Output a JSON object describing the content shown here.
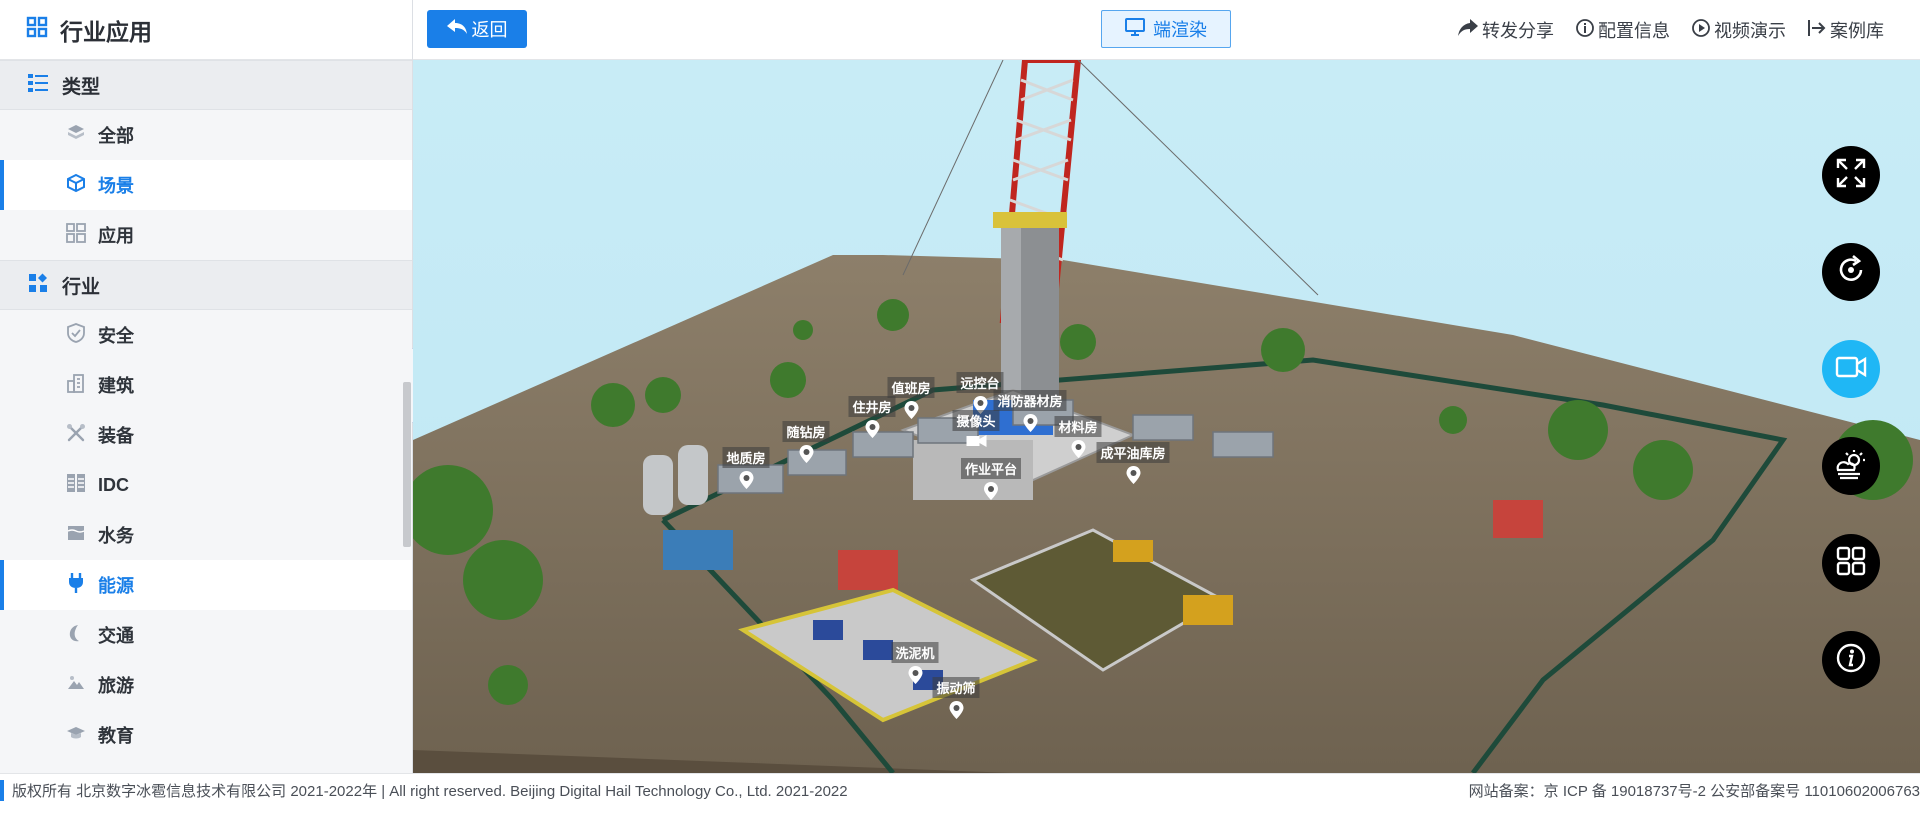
{
  "sidebar": {
    "title": "行业应用",
    "sections": [
      {
        "label": "类型",
        "items": [
          {
            "label": "全部",
            "icon": "cube-stack-icon"
          },
          {
            "label": "场景",
            "icon": "cube-icon",
            "active": true
          },
          {
            "label": "应用",
            "icon": "grid-apps-icon"
          }
        ]
      },
      {
        "label": "行业",
        "items": [
          {
            "label": "安全",
            "icon": "shield-icon"
          },
          {
            "label": "建筑",
            "icon": "building-icon"
          },
          {
            "label": "装备",
            "icon": "tools-icon"
          },
          {
            "label": "IDC",
            "icon": "server-icon"
          },
          {
            "label": "水务",
            "icon": "water-icon"
          },
          {
            "label": "能源",
            "icon": "plug-icon",
            "active": true
          },
          {
            "label": "交通",
            "icon": "moon-road-icon"
          },
          {
            "label": "旅游",
            "icon": "travel-icon"
          },
          {
            "label": "教育",
            "icon": "graduation-cap-icon"
          }
        ]
      }
    ]
  },
  "topbar": {
    "back_label": "返回",
    "render_label": "端渲染",
    "links": [
      {
        "label": "转发分享",
        "icon": "share-icon"
      },
      {
        "label": "配置信息",
        "icon": "info-icon"
      },
      {
        "label": "视频演示",
        "icon": "play-icon"
      },
      {
        "label": "案例库",
        "icon": "exit-icon"
      }
    ]
  },
  "scene": {
    "pois": [
      {
        "label": "值班房"
      },
      {
        "label": "住井房"
      },
      {
        "label": "随钻房"
      },
      {
        "label": "地质房"
      },
      {
        "label": "远控台"
      },
      {
        "label": "摄像头"
      },
      {
        "label": "消防器材房"
      },
      {
        "label": "材料房"
      },
      {
        "label": "成平油库房"
      },
      {
        "label": "作业平台"
      },
      {
        "label": "洗泥机"
      },
      {
        "label": "振动筛"
      }
    ],
    "tools": [
      {
        "icon": "fullscreen-icon"
      },
      {
        "icon": "rotate-icon"
      },
      {
        "icon": "video-camera-icon",
        "active": true
      },
      {
        "icon": "weather-icon"
      },
      {
        "icon": "layout-grid-icon"
      },
      {
        "icon": "info-icon"
      }
    ]
  },
  "footer": {
    "left": "版权所有 北京数字冰雹信息技术有限公司 2021-2022年 | All right reserved. Beijing Digital Hail Technology Co., Ltd. 2021-2022",
    "right": "网站备案：京 ICP 备 19018737号-2 公安部备案号 11010602006763"
  },
  "colors": {
    "accent": "#1a7fe8",
    "active_tool": "#1fb7f5"
  }
}
